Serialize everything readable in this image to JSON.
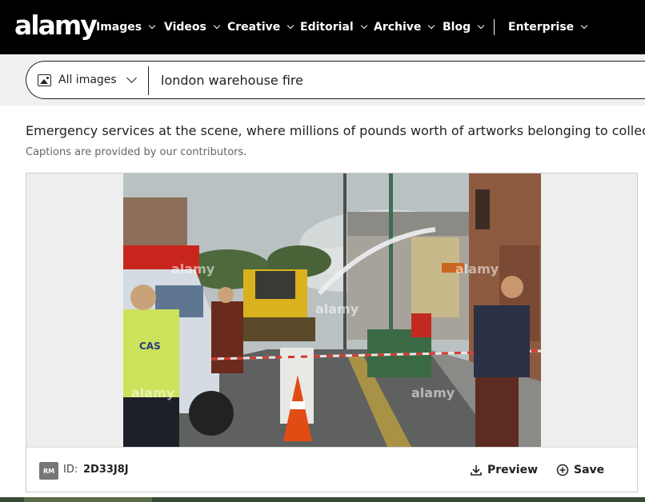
{
  "header": {
    "logo": "alamy",
    "nav": [
      {
        "label": "Images"
      },
      {
        "label": "Videos"
      },
      {
        "label": "Creative"
      },
      {
        "label": "Editorial"
      },
      {
        "label": "Archive"
      },
      {
        "label": "Blog"
      },
      {
        "label": "Enterprise"
      }
    ]
  },
  "search": {
    "type_label": "All images",
    "query": "london warehouse fire"
  },
  "caption": {
    "text": "Emergency services at the scene, where millions of pounds worth of artworks belonging to collector Ch",
    "note": "Captions are provided by our contributors."
  },
  "image": {
    "watermark": "alamy",
    "vest_text": "CAS",
    "license_badge": "RM",
    "id_label": "ID:",
    "id_value": "2D33J8J",
    "preview_label": "Preview",
    "save_label": "Save"
  },
  "colors": {
    "nav_bg": "#000000",
    "search_bg": "#f0f0f0",
    "text": "#222222"
  }
}
